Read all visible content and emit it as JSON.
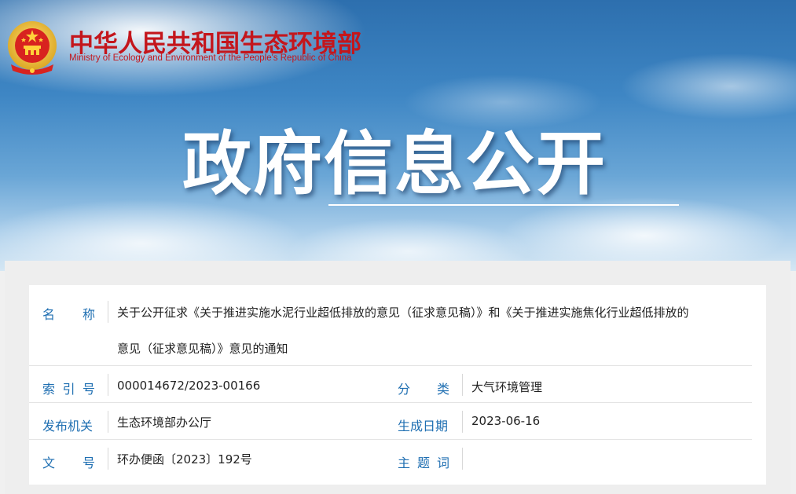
{
  "header": {
    "org_name_cn": "中华人民共和国生态环境部",
    "org_name_en": "Ministry of Ecology and Environment of the People's Republic of China",
    "emblem_icon": "national-emblem-icon"
  },
  "hero": {
    "title": "政府信息公开"
  },
  "colors": {
    "brand_red": "#c4161c",
    "label_blue": "#1f6fb2",
    "sky_blue": "#3e86c4"
  },
  "info": {
    "name": {
      "label_chars": [
        "名",
        "称"
      ],
      "value_line1": "关于公开征求《关于推进实施水泥行业超低排放的意见（征求意见稿）》和《关于推进实施焦化行业超低排放的",
      "value_line2": "意见（征求意见稿）》意见的通知"
    },
    "index_no": {
      "label_chars": [
        "索",
        "引",
        "号"
      ],
      "value": "000014672/2023-00166"
    },
    "category": {
      "label_chars": [
        "分",
        "类"
      ],
      "value": "大气环境管理"
    },
    "issuer": {
      "label": "发布机关",
      "value": "生态环境部办公厅"
    },
    "date": {
      "label": "生成日期",
      "value": "2023-06-16"
    },
    "doc_no": {
      "label_chars": [
        "文",
        "号"
      ],
      "value": "环办便函〔2023〕192号"
    },
    "subject": {
      "label_chars": [
        "主",
        "题",
        "词"
      ],
      "value": ""
    }
  }
}
